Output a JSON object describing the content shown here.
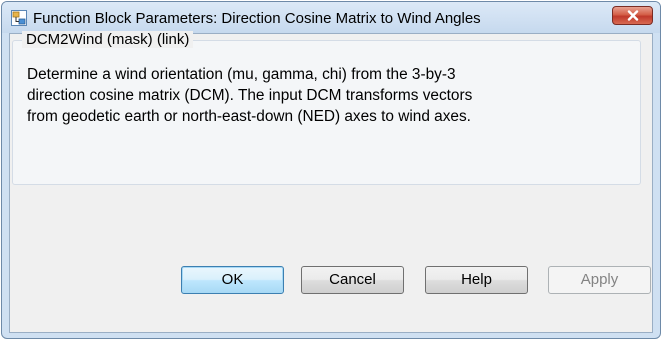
{
  "window": {
    "title": "Function Block Parameters: Direction Cosine Matrix to Wind Angles",
    "icon": "simulink-block-icon",
    "close_icon": "close-x-icon"
  },
  "group": {
    "title": "DCM2Wind (mask) (link)",
    "description_lines": [
      "Determine a wind orientation (mu, gamma, chi) from the 3-by-3",
      "direction cosine matrix (DCM). The input DCM transforms vectors",
      "from geodetic earth or north-east-down (NED) axes to wind axes."
    ]
  },
  "buttons": {
    "ok": "OK",
    "cancel": "Cancel",
    "help": "Help",
    "apply": "Apply"
  },
  "colors": {
    "title_bar": "#c6d9ee",
    "close_button": "#c0392b",
    "dialog_background": "#f0f0f0",
    "default_button_border": "#3c7fb1"
  }
}
